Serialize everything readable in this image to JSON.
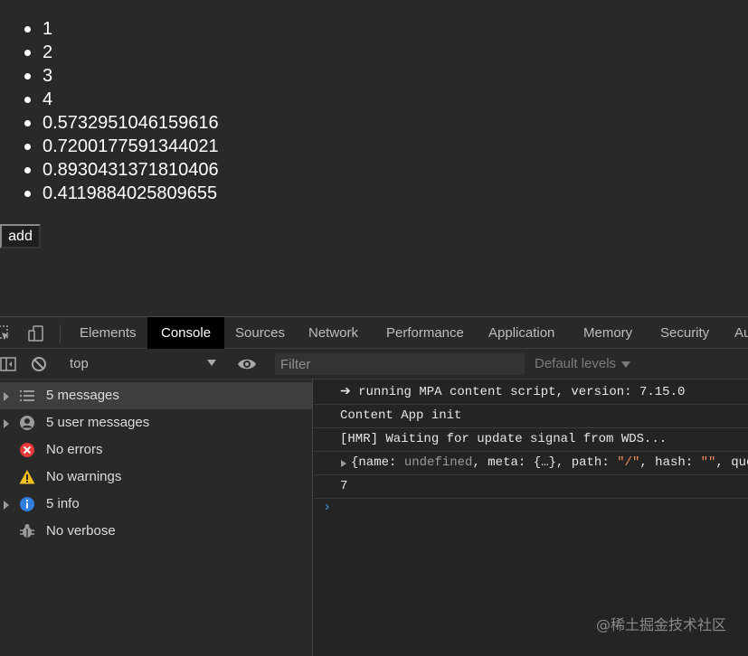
{
  "page": {
    "list_items": [
      "1",
      "2",
      "3",
      "4",
      "0.5732951046159616",
      "0.7200177591344021",
      "0.8930431371810406",
      "0.4119884025809655"
    ],
    "add_button": "add"
  },
  "devtools": {
    "tabs": [
      "Elements",
      "Console",
      "Sources",
      "Network",
      "Performance",
      "Application",
      "Memory",
      "Security",
      "Au"
    ],
    "active_tab": "Console",
    "context": "top",
    "filter_placeholder": "Filter",
    "levels_label": "Default levels",
    "sidebar": [
      {
        "label": "5 messages",
        "icon": "list-icon",
        "expandable": true,
        "selected": true
      },
      {
        "label": "5 user messages",
        "icon": "user-icon",
        "expandable": true,
        "selected": false
      },
      {
        "label": "No errors",
        "icon": "error-icon",
        "expandable": false,
        "selected": false
      },
      {
        "label": "No warnings",
        "icon": "warning-icon",
        "expandable": false,
        "selected": false
      },
      {
        "label": "5 info",
        "icon": "info-icon",
        "expandable": true,
        "selected": false
      },
      {
        "label": "No verbose",
        "icon": "bug-icon",
        "expandable": false,
        "selected": false
      }
    ],
    "console_messages": [
      "➔ running MPA content script, version: 7.15.0",
      "Content App init",
      "[HMR] Waiting for update signal from WDS..."
    ],
    "object_log": {
      "open": "{",
      "k1": "name:",
      "v1": "undefined",
      "k2": "meta:",
      "v2": "{…}",
      "k3": "path:",
      "v3": "\"/\"",
      "k4": "hash:",
      "v4": "\"\"",
      "tail": "que"
    },
    "number_log": "7",
    "prompt": "›"
  },
  "watermark": "@稀土掘金技术社区",
  "colors": {
    "page_bg": "#292929",
    "active_tab_bg": "#000000",
    "error_red": "#e8393a",
    "warning_yellow": "#f2c01d",
    "info_blue": "#2f7fe0",
    "number_purple": "#9980ff",
    "prompt_blue": "#4a90e2"
  }
}
